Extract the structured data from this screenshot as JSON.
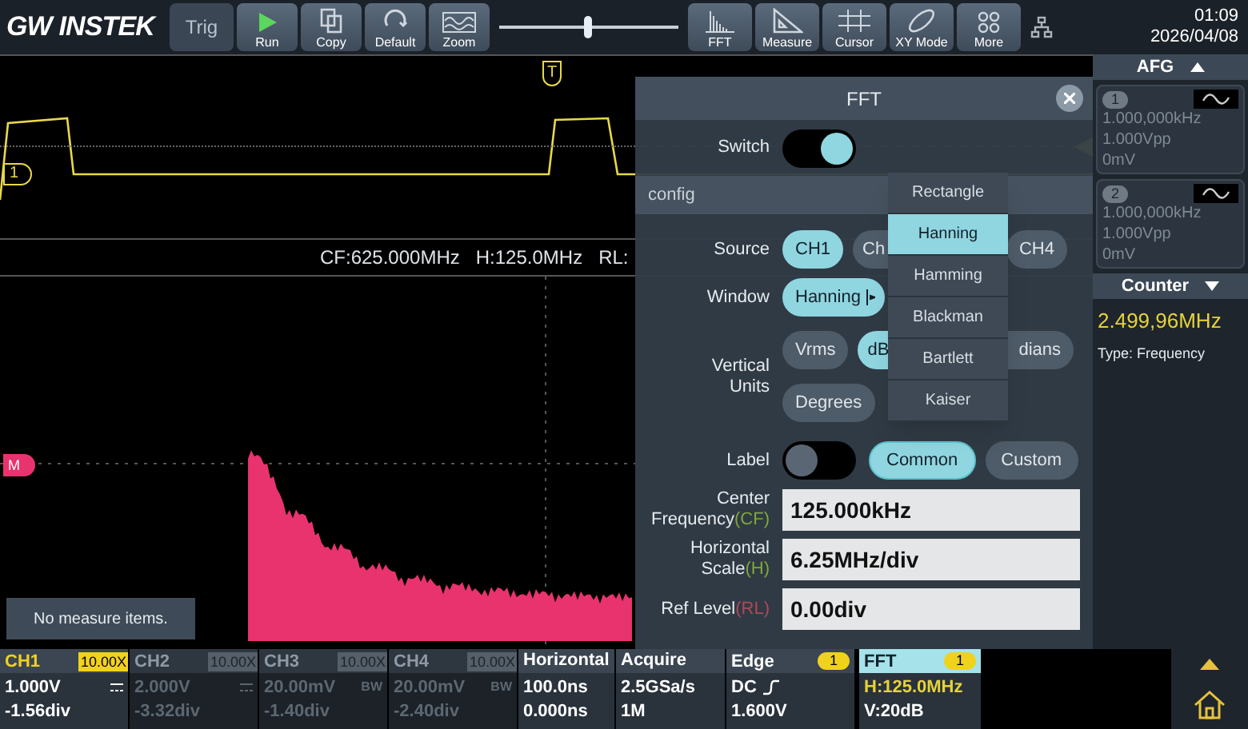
{
  "toolbar": {
    "logo": "GW INSTEK",
    "left_buttons": [
      {
        "label": "Trig",
        "kind": "text"
      },
      {
        "label": "Run",
        "kind": "run"
      },
      {
        "label": "Copy",
        "kind": "copy"
      },
      {
        "label": "Default",
        "kind": "default"
      },
      {
        "label": "Zoom",
        "kind": "zoom"
      }
    ],
    "position_slider": {
      "level": 0.47
    },
    "right_buttons": [
      {
        "label": "FFT",
        "kind": "fft"
      },
      {
        "label": "Measure",
        "kind": "measure"
      },
      {
        "label": "Cursor",
        "kind": "cursor"
      },
      {
        "label": "XY Mode",
        "kind": "xy"
      },
      {
        "label": "More",
        "kind": "more"
      }
    ],
    "time": "01:09",
    "date": "2026/04/08"
  },
  "scope": {
    "trigger_marker": "T",
    "channel_marker": "1",
    "fft_marker": "M",
    "readouts": [
      "CF:625.000MHz",
      "H:125.0MHz",
      "RL:"
    ],
    "measure_note": "No measure items."
  },
  "afg": {
    "title": "AFG",
    "channels": [
      {
        "number": "1",
        "frequency": "1.000,000kHz",
        "amplitude": "1.000Vpp",
        "offset": "0mV"
      },
      {
        "number": "2",
        "frequency": "1.000,000kHz",
        "amplitude": "1.000Vpp",
        "offset": "0mV"
      }
    ]
  },
  "counter": {
    "title": "Counter",
    "value": "2.499,96MHz",
    "type": "Type: Frequency"
  },
  "fft_dialog": {
    "title": "FFT",
    "switch": {
      "label": "Switch",
      "on": true
    },
    "section": "config",
    "source": {
      "label": "Source",
      "options": [
        {
          "label": "CH1",
          "selected": true,
          "kind": "full"
        },
        {
          "label": "Ch",
          "selected": false,
          "kind": "clipped_right"
        },
        {
          "label": "CH4",
          "selected": false,
          "kind": "full"
        }
      ]
    },
    "window": {
      "label": "Window",
      "value": "Hanning"
    },
    "units": {
      "label": "Vertical Units",
      "rows": [
        [
          {
            "label": "Vrms",
            "selected": false,
            "kind": "full"
          },
          {
            "label": "dB",
            "selected": true,
            "kind": "clipped_right"
          },
          {
            "label": "dians",
            "selected": false,
            "kind": "clipped_left"
          }
        ],
        [
          {
            "label": "Degrees",
            "selected": false,
            "kind": "full"
          }
        ]
      ]
    },
    "label_row": {
      "label": "Label",
      "on": false,
      "options": [
        {
          "label": "Common",
          "selected": true
        },
        {
          "label": "Custom",
          "selected": false
        }
      ]
    },
    "fields": [
      {
        "label": "Center Frequency",
        "abbr": "(CF)",
        "color": "#7fa83a",
        "value": "125.000kHz"
      },
      {
        "label": "Horizontal Scale",
        "abbr": "(H)",
        "color": "#7fa83a",
        "value": "6.25MHz/div"
      },
      {
        "label": "Ref Level",
        "abbr": "(RL)",
        "color": "#b0485a",
        "value": "0.00div"
      }
    ],
    "window_menu": [
      {
        "label": "Rectangle",
        "selected": false
      },
      {
        "label": "Hanning",
        "selected": true
      },
      {
        "label": "Hamming",
        "selected": false
      },
      {
        "label": "Blackman",
        "selected": false
      },
      {
        "label": "Bartlett",
        "selected": false
      },
      {
        "label": "Kaiser",
        "selected": false
      }
    ]
  },
  "status_bar": {
    "channels": [
      {
        "name": "CH1",
        "probe": "10.00X",
        "scale": "1.000V",
        "offset": "-1.56div",
        "active": true
      },
      {
        "name": "CH2",
        "probe": "10.00X",
        "scale": "2.000V",
        "offset": "-3.32div",
        "active": false
      },
      {
        "name": "CH3",
        "probe": "10.00X",
        "scale": "20.00mV",
        "bw": "BW",
        "offset": "-1.40div",
        "active": false
      },
      {
        "name": "CH4",
        "probe": "10.00X",
        "scale": "20.00mV",
        "bw": "BW",
        "offset": "-2.40div",
        "active": false
      }
    ],
    "horizontal": {
      "title": "Horizontal",
      "scale": "100.0ns",
      "position": "0.000ns"
    },
    "acquire": {
      "title": "Acquire",
      "rate": "2.5GSa/s",
      "length": "1M"
    },
    "trigger": {
      "title": "Edge",
      "badge": "1",
      "coupling": "DC",
      "level": "1.600V"
    },
    "fft": {
      "title": "FFT",
      "badge": "1",
      "h": "H:125.0MHz",
      "v": "V:20dB"
    }
  }
}
